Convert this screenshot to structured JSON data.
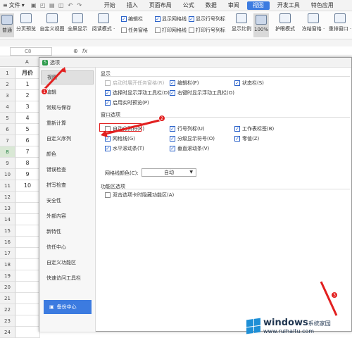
{
  "menubar": {
    "file_label": "文件",
    "tabs": [
      "开始",
      "插入",
      "页面布局",
      "公式",
      "数据",
      "审阅",
      "视图",
      "开发工具",
      "特色应用"
    ],
    "active_tab": "视图"
  },
  "ribbon": {
    "buttons": [
      {
        "label": "普通",
        "icon": "grid-icon"
      },
      {
        "label": "分页预览",
        "icon": "page-break-icon"
      },
      {
        "label": "自定义视图",
        "icon": "custom-view-icon"
      },
      {
        "label": "全屏显示",
        "icon": "fullscreen-icon"
      },
      {
        "label": "阅读模式 ·",
        "icon": "reading-mode-icon"
      }
    ],
    "checks": [
      {
        "label": "编辑栏",
        "checked": true
      },
      {
        "label": "显示网格线",
        "checked": true
      },
      {
        "label": "显示行号列标",
        "checked": true
      },
      {
        "label": "任务窗格",
        "checked": false
      },
      {
        "label": "打印网格线",
        "checked": false
      },
      {
        "label": "打印行号列标",
        "checked": false
      }
    ],
    "right_buttons": [
      {
        "label": "显示比例",
        "icon": "zoom-icon"
      },
      {
        "label": "100%",
        "icon": "zoom-100-icon"
      },
      {
        "label": "护眼模式",
        "icon": "eye-icon"
      },
      {
        "label": "冻结窗格 ·",
        "icon": "freeze-icon"
      },
      {
        "label": "重排窗口 ·",
        "icon": "arrange-icon"
      }
    ]
  },
  "formula_bar": {
    "cell_ref": "C8",
    "fx": "fx"
  },
  "sheet": {
    "col_a": "A",
    "rows": [
      "1",
      "2",
      "3",
      "4",
      "5",
      "6",
      "7",
      "8",
      "9",
      "10",
      "11",
      "12",
      "13",
      "14",
      "15",
      "16",
      "17",
      "18",
      "19",
      "20",
      "21",
      "22",
      "23",
      "24"
    ],
    "col_a_values": [
      "月价",
      "1",
      "2",
      "3",
      "4",
      "5",
      "6",
      "7",
      "8",
      "9",
      "10"
    ]
  },
  "dialog": {
    "title": "选项",
    "sidebar": [
      "视图",
      "编辑",
      "常规与保存",
      "重新计算",
      "自定义序列",
      "颜色",
      "错误检查",
      "拼写检查",
      "安全性",
      "外部内容",
      "新特性",
      "信任中心",
      "自定义功能区",
      "快速访问工具栏"
    ],
    "backup_label": "备份中心",
    "sections": {
      "display": "显示",
      "window": "窗口选项",
      "ribbon": "功能区选项"
    },
    "display_options": [
      {
        "label": "启动时展开任务窗格(R)",
        "checked": false,
        "disabled": true
      },
      {
        "label": "编辑栏(F)",
        "checked": true
      },
      {
        "label": "状态栏(S)",
        "checked": true
      },
      {
        "label": "选择时显示浮动工具栏(D)",
        "checked": true
      },
      {
        "label": "右键时显示浮动工具栏(O)",
        "checked": true
      },
      {
        "label": "启用实时预览(P)",
        "checked": true
      }
    ],
    "window_options": [
      {
        "label": "自动分页符(K)",
        "checked": false
      },
      {
        "label": "行号列标(U)",
        "checked": true
      },
      {
        "label": "工作表标签(B)",
        "checked": true
      },
      {
        "label": "网格线(G)",
        "checked": true
      },
      {
        "label": "分级显示符号(O)",
        "checked": true
      },
      {
        "label": "零值(Z)",
        "checked": true
      },
      {
        "label": "水平滚动条(T)",
        "checked": true
      },
      {
        "label": "垂直滚动条(V)",
        "checked": true
      }
    ],
    "gridline_color_label": "网格线颜色(C):",
    "gridline_color_value": "自动",
    "ribbon_options": [
      {
        "label": "双击选项卡时隐藏功能区(A)",
        "checked": false
      }
    ]
  },
  "annotations": {
    "badge1": "1",
    "badge2": "2",
    "badge3": "3",
    "color": "#e21f1f"
  },
  "watermark": {
    "brand": "windows",
    "sub": "系统家园",
    "url": "www.ruihaitu.com"
  }
}
